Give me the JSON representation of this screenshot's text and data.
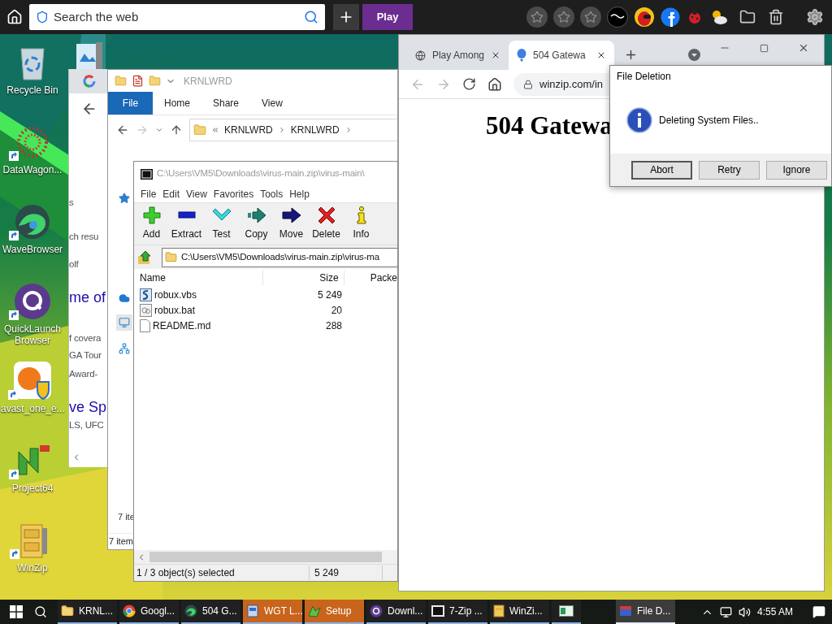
{
  "top_bar": {
    "search": {
      "placeholder": "Search the web"
    },
    "play_button": "Play"
  },
  "desktop_icons": [
    {
      "kind": "recycle",
      "label": "Recycle Bin",
      "shortcut": false
    },
    {
      "kind": "dots",
      "label": "DataWagon...",
      "shortcut": true
    },
    {
      "kind": "wave",
      "label": "WaveBrowser",
      "shortcut": true
    },
    {
      "kind": "launcher",
      "label": "QuickLaunch Browser",
      "shortcut": true
    },
    {
      "kind": "antivirus",
      "label": "avast_one_e...",
      "shortcut": true
    },
    {
      "kind": "emulator",
      "label": "Project64",
      "shortcut": true
    },
    {
      "kind": "archive",
      "label": "WinZip",
      "shortcut": true
    }
  ],
  "search_window": {
    "fragments": [
      {
        "kind": "text",
        "text": "s"
      },
      {
        "kind": "text",
        "text": "ch resu"
      },
      {
        "kind": "text",
        "text": "olf"
      },
      {
        "kind": "heading",
        "text": "me of"
      },
      {
        "kind": "text",
        "text": "f covera"
      },
      {
        "kind": "text",
        "text": "GA Tour"
      },
      {
        "kind": "text",
        "text": "Award-"
      },
      {
        "kind": "heading",
        "text": "ve Sp"
      },
      {
        "kind": "text",
        "text": "LS, UFC"
      }
    ]
  },
  "explorer": {
    "title": "KRNLWRD",
    "ribbon_tabs": [
      {
        "label": "File",
        "selected": true
      },
      {
        "label": "Home",
        "selected": false
      },
      {
        "label": "Share",
        "selected": false
      },
      {
        "label": "View",
        "selected": false
      }
    ],
    "breadcrumb": [
      "KRNLWRD",
      "KRNLWRD"
    ],
    "nav_pane": [
      {
        "kind": "quick_access",
        "selected": false
      },
      {
        "kind": "cloud",
        "selected": false
      },
      {
        "kind": "computer",
        "selected": true
      },
      {
        "kind": "network",
        "selected": false
      }
    ],
    "item_count": "7 ite",
    "status": "7 item"
  },
  "archive_manager": {
    "title": "C:\\Users\\VM5\\Downloads\\virus-main.zip\\virus-main\\",
    "menu": [
      "File",
      "Edit",
      "View",
      "Favorites",
      "Tools",
      "Help"
    ],
    "toolbar": [
      {
        "kind": "add",
        "label": "Add"
      },
      {
        "kind": "extract",
        "label": "Extract"
      },
      {
        "kind": "test",
        "label": "Test"
      },
      {
        "kind": "copy",
        "label": "Copy"
      },
      {
        "kind": "move",
        "label": "Move"
      },
      {
        "kind": "delete",
        "label": "Delete"
      },
      {
        "kind": "info",
        "label": "Info"
      }
    ],
    "address": "C:\\Users\\VM5\\Downloads\\virus-main.zip\\virus-ma",
    "columns": [
      "Name",
      "Size",
      "Packe"
    ],
    "rows": [
      {
        "kind": "script",
        "name": "robux.vbs",
        "size": "5 249"
      },
      {
        "kind": "batch",
        "name": "robux.bat",
        "size": "20"
      },
      {
        "kind": "text",
        "name": "README.md",
        "size": "288"
      }
    ],
    "status": {
      "selection": "1 / 3 object(s) selected",
      "size": "5 249"
    }
  },
  "browser": {
    "tabs": [
      {
        "kind": "globe",
        "title": "Play Among",
        "selected": false
      },
      {
        "kind": "balloon",
        "title": "504 Gatewa",
        "selected": true
      }
    ],
    "address": "winzip.com/in",
    "heading": "504 Gatewa"
  },
  "dialog": {
    "title": "File Deletion",
    "message": "Deleting System Files..",
    "buttons": [
      {
        "label": "Abort",
        "focused": true
      },
      {
        "label": "Retry",
        "focused": false
      },
      {
        "label": "Ignore",
        "focused": false
      }
    ]
  },
  "taskbar": {
    "items": [
      {
        "kind": "folder",
        "label": "KRNL...",
        "flashing": false,
        "selected": false
      },
      {
        "kind": "chrome",
        "label": "Googl...",
        "flashing": false,
        "selected": false
      },
      {
        "kind": "wave",
        "label": "504 G...",
        "flashing": false,
        "selected": false
      },
      {
        "kind": "installer",
        "label": "WGT L...",
        "flashing": true,
        "selected": false
      },
      {
        "kind": "setup",
        "label": "Setup",
        "flashing": true,
        "selected": false
      },
      {
        "kind": "launcher",
        "label": "Downl...",
        "flashing": false,
        "selected": false
      },
      {
        "kind": "sevenzip",
        "label": "7-Zip ...",
        "flashing": false,
        "selected": false
      },
      {
        "kind": "archive",
        "label": "WinZi...",
        "flashing": false,
        "selected": false
      },
      {
        "kind": "window",
        "flashing": false,
        "selected": false
      },
      {
        "kind": "dialog",
        "label": "File D...",
        "flashing": false,
        "selected": true
      }
    ],
    "clock": "4:55 AM"
  }
}
